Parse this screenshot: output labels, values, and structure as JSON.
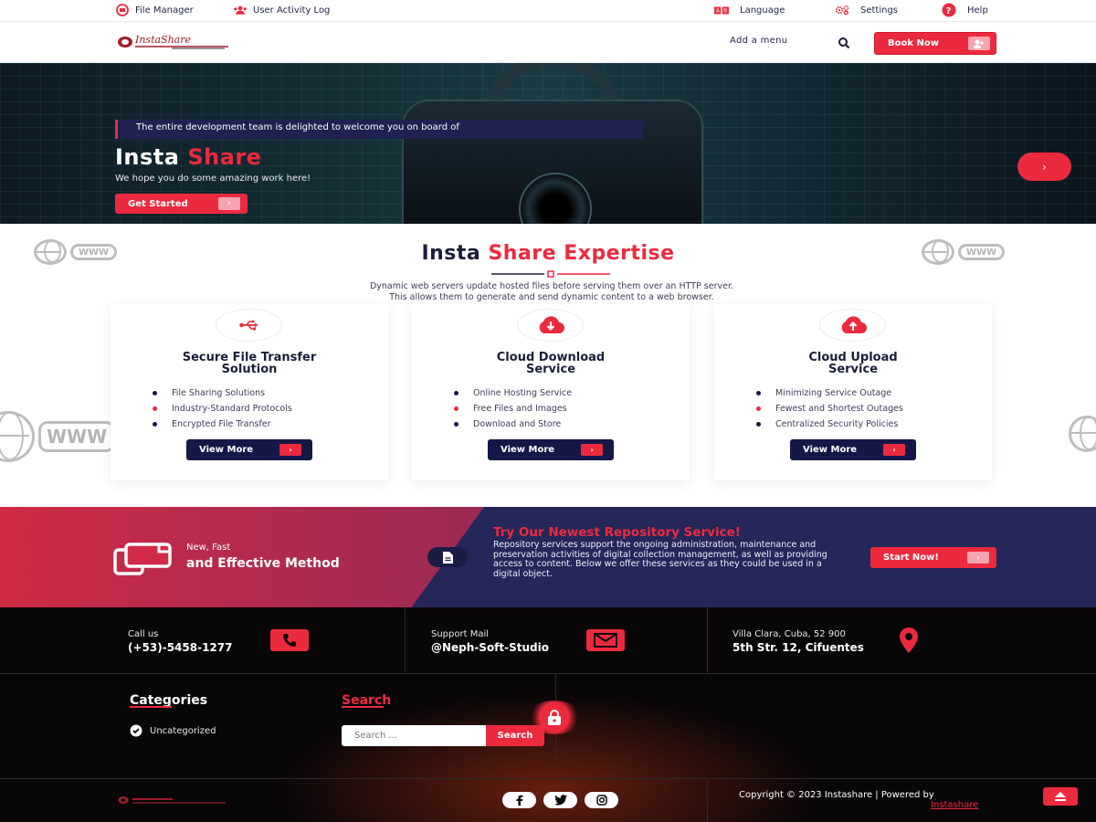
{
  "topbar": {
    "file_manager": "File Manager",
    "user_activity": "User Activity Log",
    "language": "Language",
    "settings": "Settings",
    "help": "Help"
  },
  "header": {
    "logo_text": "InstaShare",
    "menu_link": "Add a menu",
    "book_now": "Book Now"
  },
  "hero": {
    "banner": "The entire development team is delighted to welcome you on board of",
    "title_a": "Insta",
    "title_b": "Share",
    "subtitle": "We hope you do some amazing work here!",
    "cta": "Get Started"
  },
  "expertise": {
    "title_a": "Insta",
    "title_b": "Share Expertise",
    "description_1": "Dynamic web servers update hosted files before serving them over an HTTP server.",
    "description_2": "This allows them to generate and send dynamic content to a web browser.",
    "www_label": "WWW",
    "cards": [
      {
        "title_1": "Secure File Transfer",
        "title_2": "Solution",
        "icon": "usb-icon",
        "items": [
          "File Sharing Solutions",
          "Industry-Standard Protocols",
          "Encrypted File Transfer"
        ],
        "button": "View More"
      },
      {
        "title_1": "Cloud Download",
        "title_2": "Service",
        "icon": "cloud-download-icon",
        "items": [
          "Online Hosting Service",
          "Free Files and Images",
          "Download and Store"
        ],
        "button": "View More"
      },
      {
        "title_1": "Cloud Upload",
        "title_2": "Service",
        "icon": "cloud-upload-icon",
        "items": [
          "Minimizing Service Outage",
          "Fewest and Shortest Outages",
          "Centralized Security Policies"
        ],
        "button": "View More"
      }
    ]
  },
  "promo": {
    "small": "New, Fast",
    "big": "and Effective Method",
    "title": "Try Our Newest Repository Service!",
    "text": "Repository services support the ongoing administration, maintenance and preservation activities of digital collection management, as well as providing access to content. Below we offer these services as they could be used in a digital object.",
    "cta": "Start Now!"
  },
  "footer": {
    "call_label": "Call us",
    "call_value": "(+53)-5458-1277",
    "mail_label": "Support Mail",
    "mail_value": "@Neph-Soft-Studio",
    "addr_label": "Villa Clara, Cuba, 52 900",
    "addr_value": "5th Str. 12, Cifuentes",
    "categories_heading": "Categories",
    "category_item": "Uncategorized",
    "search_heading": "Search",
    "search_placeholder": "Search ...",
    "search_button": "Search",
    "copyright": "Copyright © 2023 Instashare | Powered by",
    "powered_link": "Instashare"
  },
  "colors": {
    "accent": "#ec2a3e",
    "navy": "#151847",
    "dark": "#090608"
  }
}
